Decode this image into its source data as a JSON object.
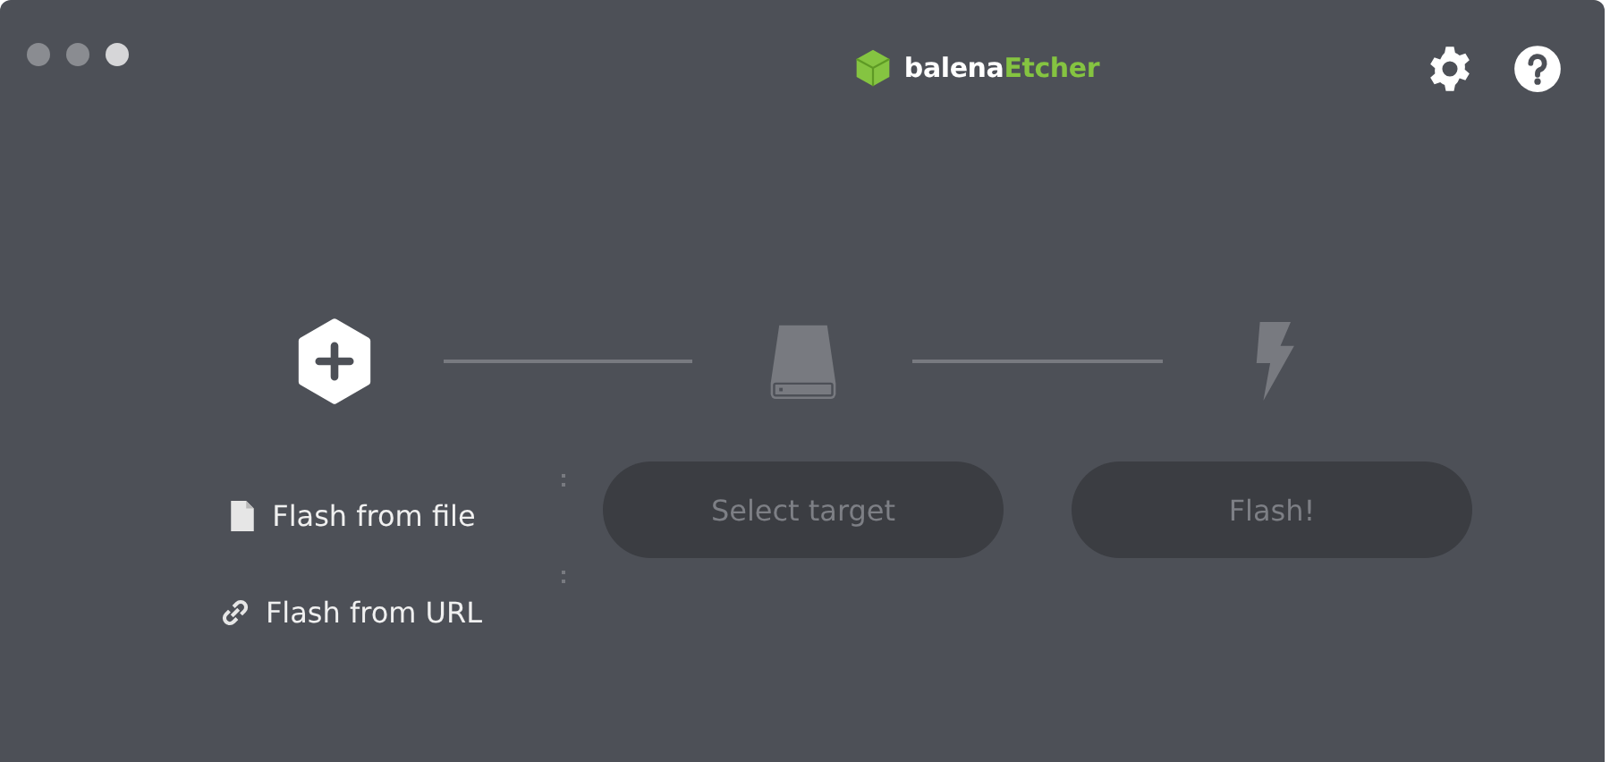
{
  "window": {
    "controls": [
      {
        "kind": "close"
      },
      {
        "kind": "minimize"
      },
      {
        "kind": "zoom"
      }
    ]
  },
  "logo": {
    "prefix": "balena",
    "name": "Etcher"
  },
  "header_buttons": [
    {
      "kind": "settings"
    },
    {
      "kind": "help"
    }
  ],
  "steps": [
    {
      "kind": "image",
      "disabled": false
    },
    {
      "kind": "drive",
      "disabled": true
    },
    {
      "kind": "flash",
      "disabled": true
    }
  ],
  "source_options": [
    {
      "kind": "file",
      "label": "Flash from file"
    },
    {
      "kind": "url",
      "label": "Flash from URL"
    }
  ],
  "buttons": [
    {
      "label": "Select target",
      "disabled": true
    },
    {
      "label": "Flash!",
      "disabled": true
    }
  ]
}
